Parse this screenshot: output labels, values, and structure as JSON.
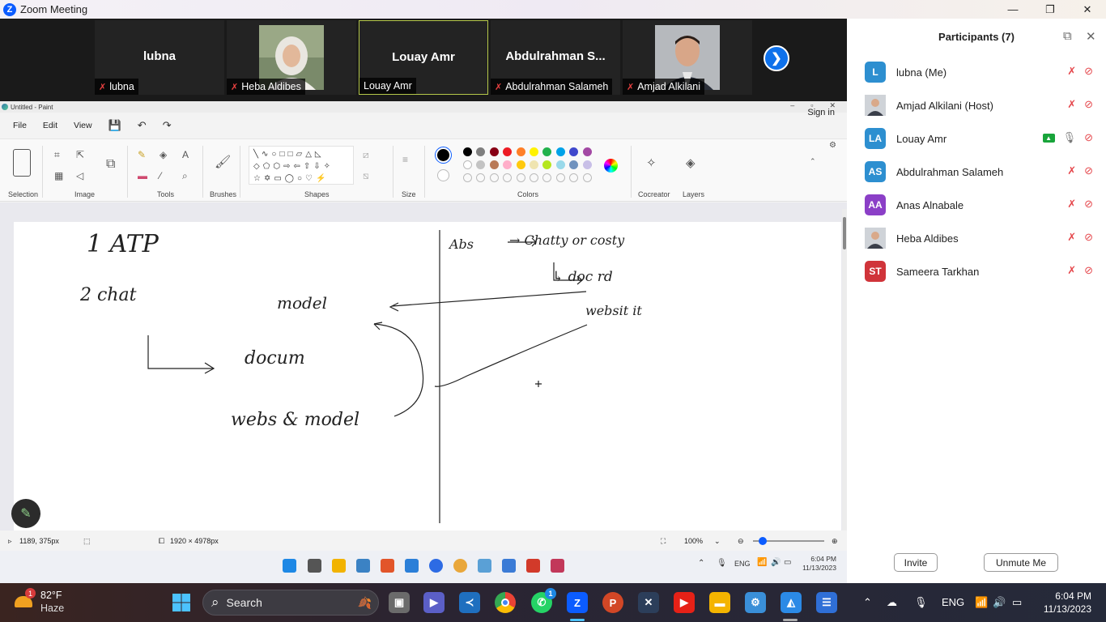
{
  "zoom": {
    "title": "Zoom Meeting",
    "window_controls": [
      "—",
      "❐",
      "✕"
    ]
  },
  "video_tiles": [
    {
      "center_name": "lubna",
      "label": "lubna",
      "muted": true,
      "photo": false,
      "active": false
    },
    {
      "center_name": "",
      "label": "Heba Aldibes",
      "muted": true,
      "photo": true,
      "active": false
    },
    {
      "center_name": "Louay Amr",
      "label": "Louay Amr",
      "muted": false,
      "photo": false,
      "active": true
    },
    {
      "center_name": "Abdulrahman  S...",
      "label": "Abdulrahman Salameh",
      "muted": true,
      "photo": false,
      "active": false
    },
    {
      "center_name": "",
      "label": "Amjad Alkilani",
      "muted": true,
      "photo": true,
      "active": false
    }
  ],
  "paint": {
    "title": "Untitled - Paint",
    "sign_in": "Sign in",
    "menu": [
      "File",
      "Edit",
      "View"
    ],
    "groups": [
      "Selection",
      "Image",
      "Tools",
      "Brushes",
      "Shapes",
      "Size",
      "Colors",
      "Cocreator",
      "Layers"
    ],
    "colors_row1": [
      "#000000",
      "#7f7f7f",
      "#880015",
      "#ed1c24",
      "#ff7f27",
      "#fff200",
      "#22b14c",
      "#00a2e8",
      "#3f48cc",
      "#a349a4"
    ],
    "colors_row2": [
      "#ffffff",
      "#c3c3c3",
      "#b97a57",
      "#ffaec9",
      "#ffc90e",
      "#efe4b0",
      "#b5e61d",
      "#99d9ea",
      "#7092be",
      "#c8bfe7"
    ],
    "status": {
      "cursor_pos": "1189, 375px",
      "canvas_size": "1920 × 4978px",
      "zoom": "100%"
    },
    "inner_clock": {
      "time": "6:04 PM",
      "date": "11/13/2023"
    },
    "inner_lang": "ENG",
    "handwriting": {
      "t1": "1 ATP",
      "t2": "2 chat",
      "t3": "model",
      "t4": "docum",
      "t5": "webs & model",
      "t6": "Abs",
      "t7": "→ Chatty or costy",
      "t8": "↳ doc rd",
      "t9": "websit it"
    }
  },
  "participants": {
    "title": "Participants (7)",
    "items": [
      {
        "name": "lubna (Me)",
        "initials": "L",
        "color": "#2d8fd0",
        "photo": false,
        "sharing": false,
        "mic_on": false
      },
      {
        "name": "Amjad Alkilani (Host)",
        "initials": "",
        "color": "#8a6b5a",
        "photo": true,
        "sharing": false,
        "mic_on": false
      },
      {
        "name": "Louay Amr",
        "initials": "LA",
        "color": "#2d8fd0",
        "photo": false,
        "sharing": true,
        "mic_on": true
      },
      {
        "name": "Abdulrahman Salameh",
        "initials": "AS",
        "color": "#2d8fd0",
        "photo": false,
        "sharing": false,
        "mic_on": false
      },
      {
        "name": "Anas Alnabale",
        "initials": "AA",
        "color": "#8b3fc7",
        "photo": false,
        "sharing": false,
        "mic_on": false
      },
      {
        "name": "Heba Aldibes",
        "initials": "",
        "color": "#c8b6a0",
        "photo": true,
        "sharing": false,
        "mic_on": false
      },
      {
        "name": "Sameera Tarkhan",
        "initials": "ST",
        "color": "#d0343a",
        "photo": false,
        "sharing": false,
        "mic_on": false
      }
    ],
    "invite": "Invite",
    "unmute": "Unmute Me"
  },
  "taskbar": {
    "weather_temp": "82°F",
    "weather_desc": "Haze",
    "weather_badge": "1",
    "search": "Search",
    "whatsapp_badge": "1",
    "lang": "ENG",
    "time": "6:04 PM",
    "date": "11/13/2023"
  }
}
